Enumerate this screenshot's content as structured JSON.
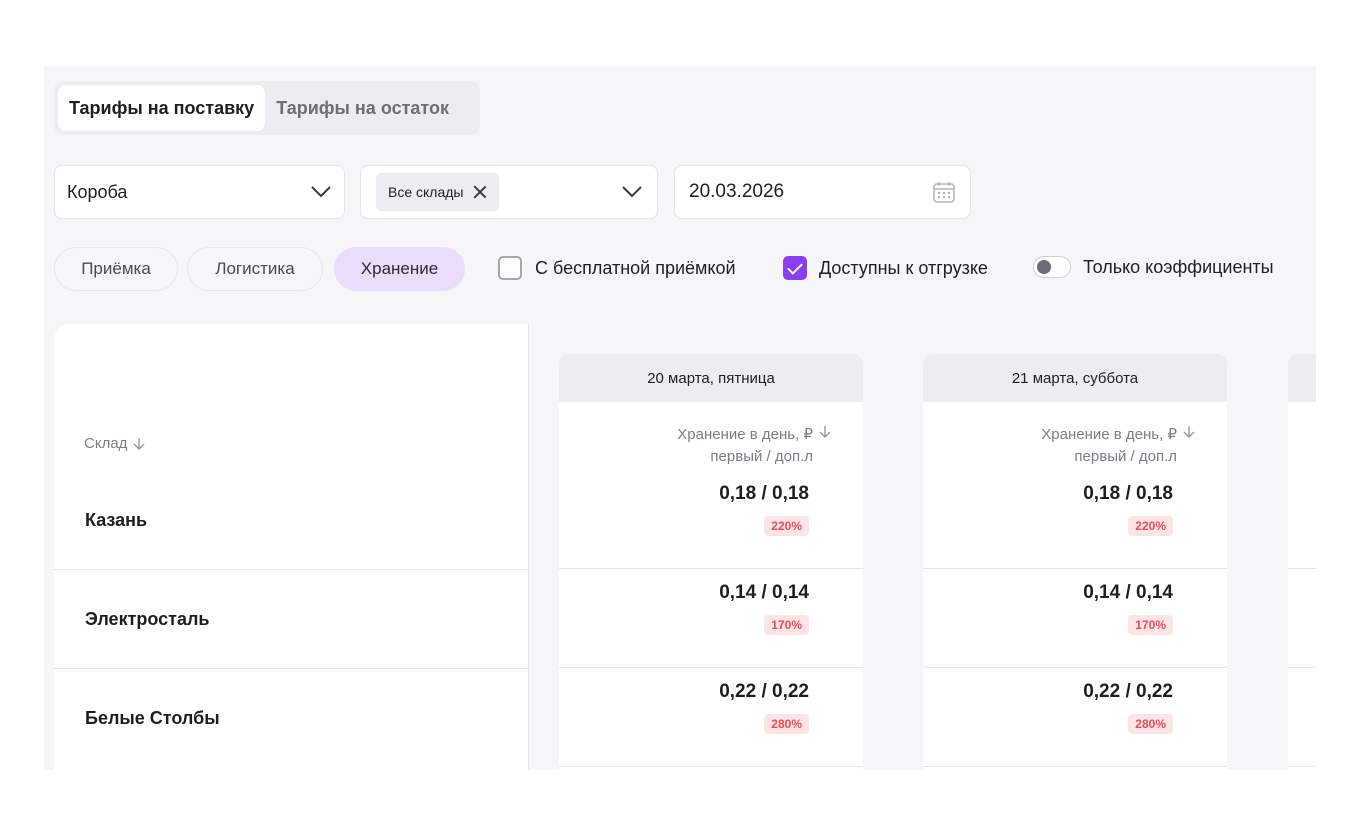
{
  "tabs": [
    {
      "label": "Тарифы на поставку",
      "active": true
    },
    {
      "label": "Тарифы на остаток",
      "active": false
    }
  ],
  "filters": {
    "type_value": "Короба",
    "warehouse_chip": "Все склады",
    "date_value": "20.03.2026"
  },
  "pills": [
    {
      "label": "Приёмка",
      "active": false
    },
    {
      "label": "Логистика",
      "active": false
    },
    {
      "label": "Хранение",
      "active": true
    }
  ],
  "options": {
    "free_acceptance": {
      "label": "С бесплатной приёмкой",
      "checked": false
    },
    "available": {
      "label": "Доступны к отгрузке",
      "checked": true
    },
    "only_coeffs": {
      "label": "Только коэффициенты",
      "on": false
    }
  },
  "table": {
    "warehouse_header": "Склад",
    "metric_line1": "Хранение в день, ₽",
    "metric_line2": "первый / доп.л",
    "dates": [
      "20 марта, пятница",
      "21 марта, суббота"
    ],
    "rows": [
      {
        "name": "Казань",
        "values": [
          "0,18 / 0,18",
          "0,18 / 0,18"
        ],
        "badges": [
          "220%",
          "220%"
        ]
      },
      {
        "name": "Электросталь",
        "values": [
          "0,14 / 0,14",
          "0,14 / 0,14"
        ],
        "badges": [
          "170%",
          "170%"
        ]
      },
      {
        "name": "Белые Столбы",
        "values": [
          "0,22 / 0,22",
          "0,22 / 0,22"
        ],
        "badges": [
          "280%",
          "280%"
        ]
      }
    ]
  },
  "colors": {
    "accent": "#8b3df2",
    "pill_active": "#ecdcfb",
    "badge_bg": "#ffe4e6",
    "badge_text": "#ee4b5a"
  }
}
